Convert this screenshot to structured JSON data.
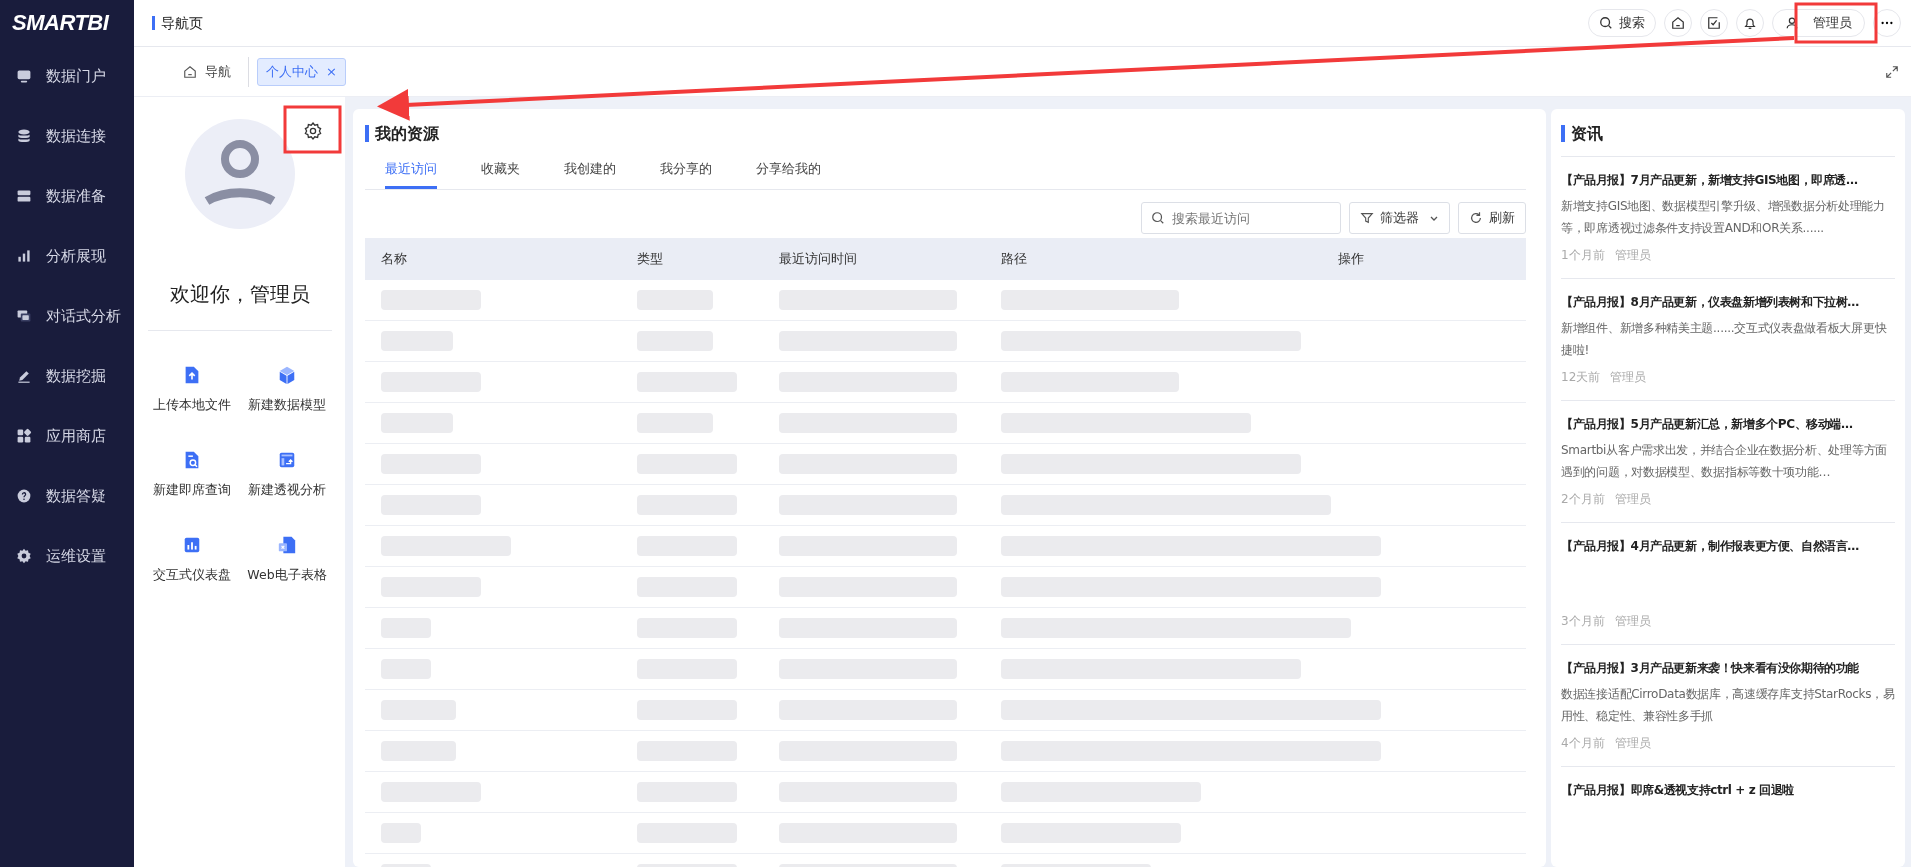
{
  "sidebar": {
    "logo": "SMARTBI",
    "items": [
      {
        "label": "数据门户"
      },
      {
        "label": "数据连接"
      },
      {
        "label": "数据准备"
      },
      {
        "label": "分析展现"
      },
      {
        "label": "对话式分析"
      },
      {
        "label": "数据挖掘"
      },
      {
        "label": "应用商店"
      },
      {
        "label": "数据答疑"
      },
      {
        "label": "运维设置"
      }
    ]
  },
  "topbar": {
    "title": "导航页",
    "search": "搜索",
    "user": "管理员"
  },
  "tabs": [
    {
      "label": "导航",
      "selected": false
    },
    {
      "label": "个人中心",
      "selected": true,
      "close": "×"
    }
  ],
  "profile": {
    "welcome": "欢迎你，管理员",
    "actions": [
      "上传本地文件",
      "新建数据模型",
      "新建即席查询",
      "新建透视分析",
      "交互式仪表盘",
      "Web电子表格"
    ]
  },
  "resources": {
    "title": "我的资源",
    "tabs": [
      {
        "label": "最近访问",
        "selected": true
      },
      {
        "label": "收藏夹",
        "selected": false
      },
      {
        "label": "我创建的",
        "selected": false
      },
      {
        "label": "我分享的",
        "selected": false
      },
      {
        "label": "分享给我的",
        "selected": false
      }
    ],
    "search": {
      "placeholder": "搜索最近访问"
    },
    "filter": "筛选器",
    "refresh": "刷新",
    "columns": [
      "名称",
      "类型",
      "最近访问时间",
      "路径",
      "操作"
    ]
  },
  "news": {
    "title": "资讯",
    "items": [
      {
        "title": "【产品月报】7月产品更新，新增支持GIS地图，即席透…",
        "summary": "新增支持GIS地图、数据模型引擎升级、增强数据分析处理能力等，即席透视过滤条件支持设置AND和OR关系......",
        "time": "1个月前",
        "author": "管理员"
      },
      {
        "title": "【产品月报】8月产品更新，仪表盘新增列表树和下拉树…",
        "summary": "新增组件、新增多种精美主题......交互式仪表盘做看板大屏更快捷啦!",
        "time": "12天前",
        "author": "管理员"
      },
      {
        "title": "【产品月报】5月产品更新汇总，新增多个PC、移动端…",
        "summary": "Smartbi从客户需求出发，并结合企业在数据分析、处理等方面遇到的问题，对数据模型、数据指标等数十项功能…",
        "time": "2个月前",
        "author": "管理员"
      },
      {
        "title": "【产品月报】4月产品更新，制作报表更方便、自然语言…",
        "time": "3个月前",
        "author": "管理员"
      },
      {
        "title": "【产品月报】3月产品更新来袭！快来看有没你期待的功能",
        "summary": "数据连接适配CirroData数据库，高速缓存库支持StarRocks，易用性、稳定性、兼容性多手抓",
        "time": "4个月前",
        "author": "管理员"
      },
      {
        "title": "【产品月报】即席&透视支持ctrl + z 回退啦"
      }
    ]
  }
}
